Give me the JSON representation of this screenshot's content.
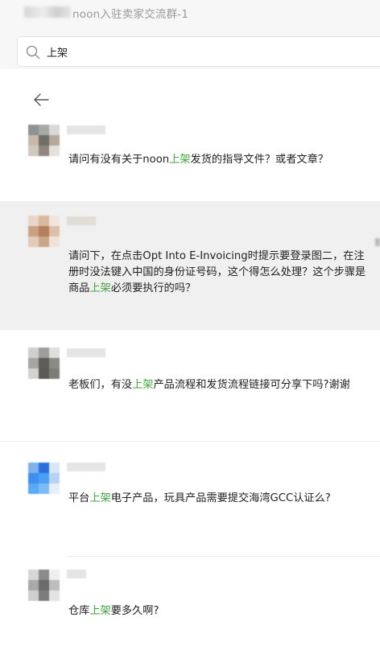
{
  "window": {
    "title": "noon入驻卖家交流群-1"
  },
  "search": {
    "query": "上架",
    "icon": "search-icon"
  },
  "nav": {
    "back_icon": "arrow-left-icon"
  },
  "results": [
    {
      "before": "请问有没有关于noon",
      "keyword": "上架",
      "after": "发货的指导文件？或者文章？",
      "highlighted": false
    },
    {
      "before": "请问下，在点击Opt Into E-Invoicing时提示要登录图二，在注册时没法键入中国的身份证号码，这个得怎么处理？这个步骤是商品",
      "keyword": "上架",
      "after": "必须要执行的吗？",
      "highlighted": true
    },
    {
      "before": "老板们，有没",
      "keyword": "上架",
      "after": "产品流程和发货流程链接可分享下吗?谢谢",
      "highlighted": false
    },
    {
      "before": "平台",
      "keyword": "上架",
      "after": "电子产品，玩具产品需要提交海湾GCC认证么?",
      "highlighted": false
    },
    {
      "before": "仓库",
      "keyword": "上架",
      "after": "要多久啊?",
      "highlighted": false
    }
  ],
  "colors": {
    "keyword": "#3da73a",
    "highlight_row": "#f0f0f0",
    "chrome": "#f7f7f7"
  }
}
